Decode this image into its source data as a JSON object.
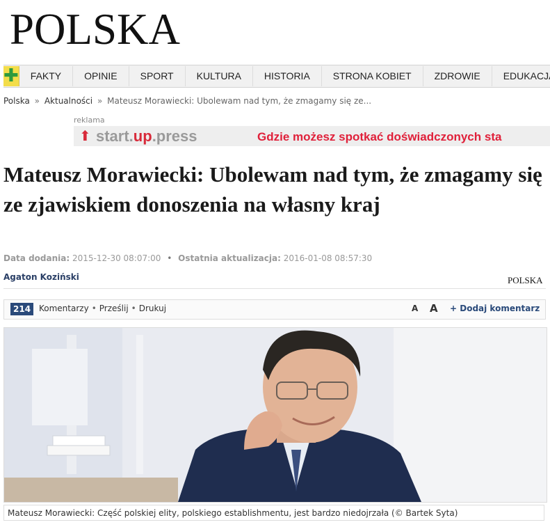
{
  "site": {
    "logo": "POLSKA",
    "small_logo": "POLSKA"
  },
  "nav": {
    "plus_icon": "plus-icon",
    "items": [
      "FAKTY",
      "OPINIE",
      "SPORT",
      "KULTURA",
      "HISTORIA",
      "STRONA KOBIET",
      "ZDROWIE",
      "EDUKACJA"
    ]
  },
  "breadcrumb": {
    "items": [
      "Polska",
      "Aktualności"
    ],
    "separator": "»",
    "current": "Mateusz Morawiecki: Ubolewam nad tym, że zmagamy się ze..."
  },
  "ad": {
    "label": "reklama",
    "brand_start": "start.",
    "brand_up": "up",
    "brand_press": ".press",
    "slogan": "Gdzie możesz spotkać doświadczonych sta"
  },
  "article": {
    "title": "Mateusz Morawiecki: Ubolewam nad tym, że zmagamy się ze zjawiskiem donoszenia na własny kraj",
    "added_label": "Data dodania:",
    "added_value": "2015-12-30 08:07:00",
    "updated_label": "Ostatnia aktualizacja:",
    "updated_value": "2016-01-08 08:57:30",
    "author": "Agaton Koziński"
  },
  "toolbar": {
    "comments_count": "214",
    "comments_label": "Komentarzy",
    "share_label": "Prześlij",
    "print_label": "Drukuj",
    "font_small": "A",
    "font_large": "A",
    "add_comment": "+ Dodaj komentarz"
  },
  "photo": {
    "caption": "Mateusz Morawiecki: Część polskiej elity, polskiego establishmentu, jest bardzo niedojrzała (© Bartek Syta)"
  },
  "colors": {
    "accent_navy": "#2a4a7a",
    "plus_bg": "#f3dd4a",
    "plus_fg": "#2e9a3e",
    "ad_red": "#e0203a",
    "suit": "#1f2d4f"
  }
}
